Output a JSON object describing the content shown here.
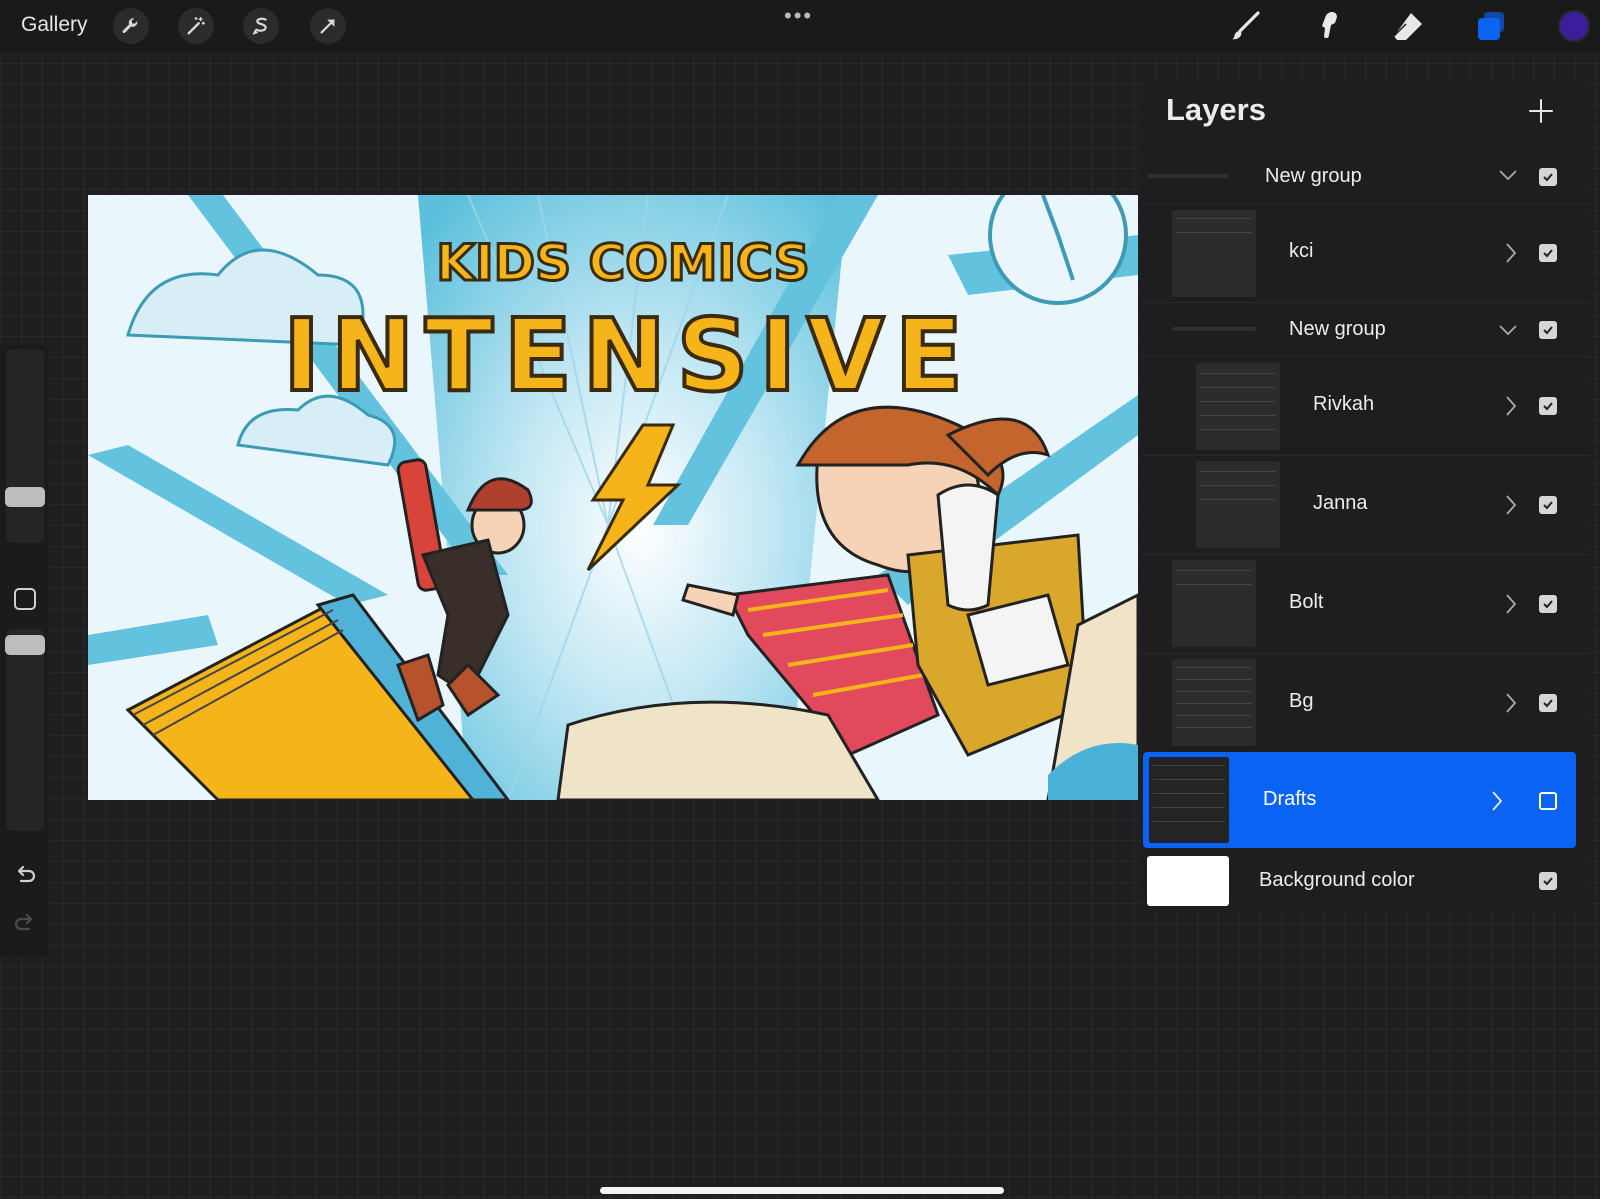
{
  "app": {
    "name": "Procreate"
  },
  "topbar": {
    "gallery_label": "Gallery",
    "left_tools": [
      "wrench-icon",
      "magic-wand-icon",
      "selection-s-icon",
      "transform-arrow-icon"
    ],
    "right_tools": [
      "brush-icon",
      "smudge-icon",
      "eraser-icon",
      "layers-icon"
    ],
    "active_color": "#3c1d9c"
  },
  "canvas": {
    "title_line1": "KIDS COMICS",
    "title_line2": "INTENSIVE"
  },
  "layers": {
    "title": "Layers",
    "items": [
      {
        "name": "New group",
        "type": "group",
        "expanded": true,
        "visible": true
      },
      {
        "name": "kci",
        "type": "group",
        "expanded": false,
        "visible": true
      },
      {
        "name": "New group",
        "type": "group",
        "expanded": true,
        "visible": true
      },
      {
        "name": "Rivkah",
        "type": "group",
        "expanded": false,
        "visible": true
      },
      {
        "name": "Janna",
        "type": "group",
        "expanded": false,
        "visible": true
      },
      {
        "name": "Bolt",
        "type": "group",
        "expanded": false,
        "visible": true
      },
      {
        "name": "Bg",
        "type": "group",
        "expanded": false,
        "visible": true
      },
      {
        "name": "Drafts",
        "type": "group",
        "expanded": false,
        "visible": false,
        "selected": true
      },
      {
        "name": "Background color",
        "type": "background",
        "visible": true,
        "color": "#ffffff"
      }
    ]
  },
  "colors": {
    "accent": "#0a63f2",
    "title_yellow": "#f4b41a",
    "sky_blue": "#5bc0de"
  }
}
